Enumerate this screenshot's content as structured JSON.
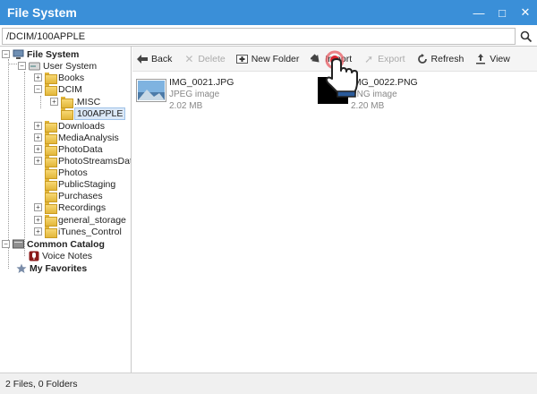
{
  "window": {
    "title": "File System"
  },
  "pathbar": {
    "path": "/DCIM/100APPLE"
  },
  "tree": {
    "root": "File System",
    "user_system": "User System",
    "books": "Books",
    "dcim": "DCIM",
    "misc": ".MISC",
    "apple100": "100APPLE",
    "downloads": "Downloads",
    "media_analysis": "MediaAnalysis",
    "photo_data": "PhotoData",
    "photo_streams": "PhotoStreamsData",
    "photos": "Photos",
    "public_staging": "PublicStaging",
    "purchases": "Purchases",
    "recordings": "Recordings",
    "general_storage": "general_storage",
    "itunes_control": "iTunes_Control",
    "common_catalog": "Common Catalog",
    "voice_notes": "Voice Notes",
    "my_favorites": "My Favorites"
  },
  "toolbar": {
    "back": "Back",
    "delete": "Delete",
    "new_folder": "New Folder",
    "import": "Import",
    "export": "Export",
    "refresh": "Refresh",
    "view": "View"
  },
  "files": [
    {
      "name": "IMG_0021.JPG",
      "type": "JPEG image",
      "size": "2.02 MB"
    },
    {
      "name": "IMG_0022.PNG",
      "type": "PNG image",
      "size": "2.20 MB"
    }
  ],
  "status": {
    "text": "2 Files, 0 Folders"
  },
  "colors": {
    "titlebar": "#3a8fd8",
    "accent_red": "#d9232e"
  }
}
